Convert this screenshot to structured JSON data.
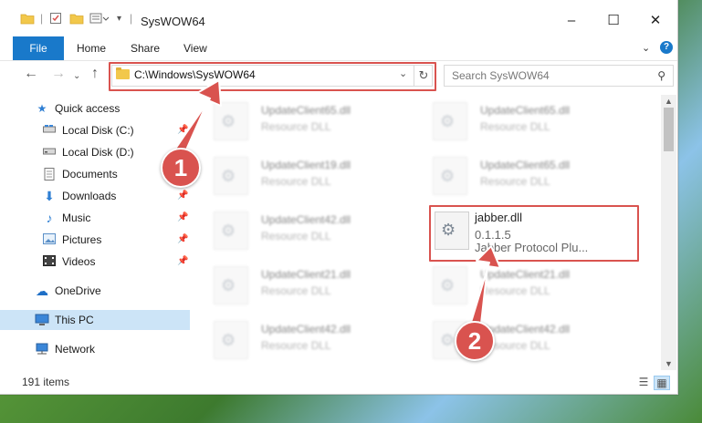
{
  "window": {
    "title": "SysWOW64",
    "controls": {
      "minimize": "–",
      "maximize": "☐",
      "close": "✕"
    }
  },
  "ribbon": {
    "tabs": [
      "File",
      "Home",
      "Share",
      "View"
    ],
    "help": "?"
  },
  "address_bar": {
    "path": "C:\\Windows\\SysWOW64",
    "refresh": "↻",
    "search_placeholder": "Search SysWOW64"
  },
  "sidebar": {
    "items": [
      {
        "label": "Quick access",
        "icon": "star-icon",
        "pinned": false
      },
      {
        "label": "Local Disk (C:)",
        "icon": "drive-icon",
        "pinned": true
      },
      {
        "label": "Local Disk (D:)",
        "icon": "drive-icon",
        "pinned": true
      },
      {
        "label": "Documents",
        "icon": "documents-icon",
        "pinned": true
      },
      {
        "label": "Downloads",
        "icon": "download-icon",
        "pinned": true
      },
      {
        "label": "Music",
        "icon": "music-icon",
        "pinned": true
      },
      {
        "label": "Pictures",
        "icon": "pictures-icon",
        "pinned": true
      },
      {
        "label": "Videos",
        "icon": "videos-icon",
        "pinned": true
      },
      {
        "label": "OneDrive",
        "icon": "cloud-icon",
        "pinned": false
      },
      {
        "label": "This PC",
        "icon": "monitor-icon",
        "pinned": false,
        "selected": true
      },
      {
        "label": "Network",
        "icon": "network-icon",
        "pinned": false
      }
    ]
  },
  "files": [
    {
      "name": "UpdateClient65.dll",
      "type": "Resource DLL"
    },
    {
      "name": "UpdateClient65.dll",
      "type": "Resource DLL"
    },
    {
      "name": "UpdateClient19.dll",
      "type": "Resource DLL"
    },
    {
      "name": "UpdateClient65.dll",
      "type": "Resource DLL"
    },
    {
      "name": "UpdateClient42.dll",
      "type": "Resource DLL"
    },
    {
      "name": "UpdateClient21.dll",
      "type": "Resource DLL"
    },
    {
      "name": "UpdateClient21.dll",
      "type": "Resource DLL"
    },
    {
      "name": "UpdateClient42.dll",
      "type": "Resource DLL"
    },
    {
      "name": "UpdateClient42.dll",
      "type": "Resource DLL"
    }
  ],
  "highlighted_file": {
    "name": "jabber.dll",
    "version": "0.1.1.5",
    "description": "Jabber Protocol Plu..."
  },
  "status_bar": {
    "item_count": "191 items"
  },
  "callouts": [
    "1",
    "2"
  ],
  "colors": {
    "accent": "#1979ca",
    "highlight": "#d9534f",
    "selection": "#cce4f7"
  }
}
